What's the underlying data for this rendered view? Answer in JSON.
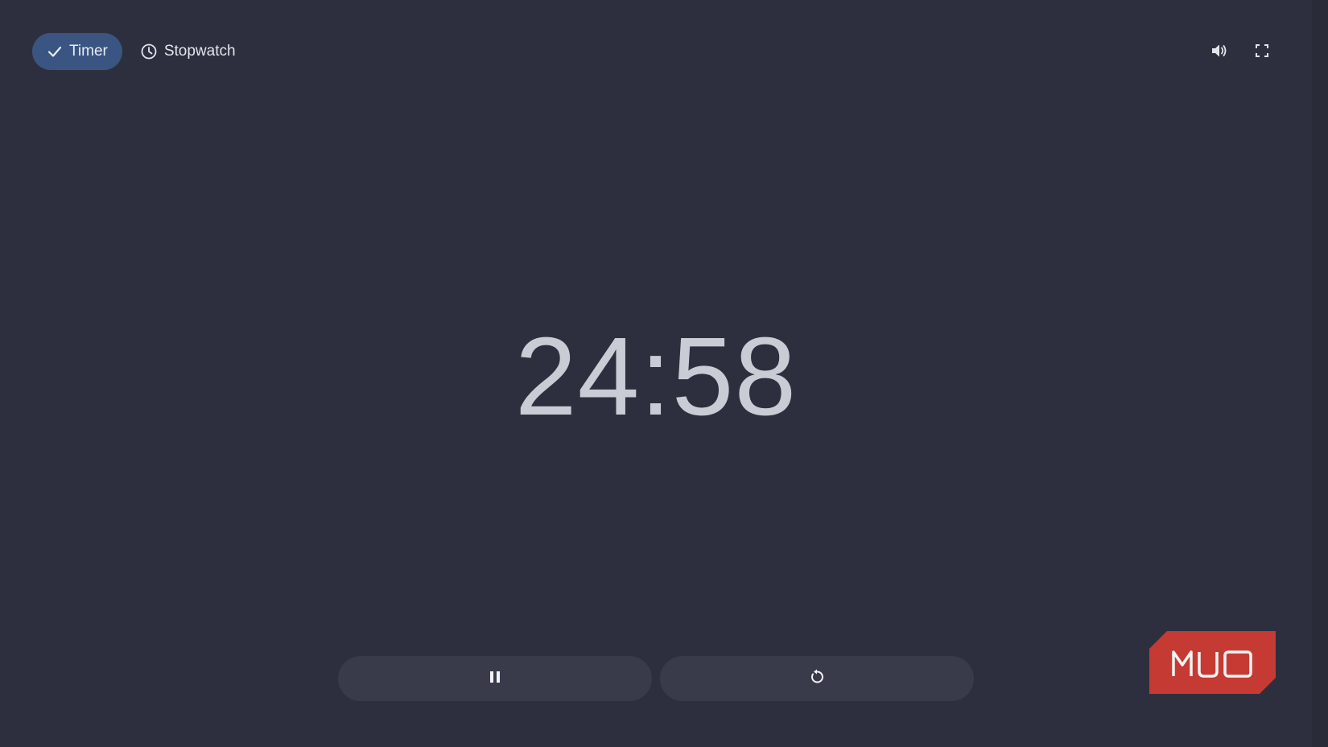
{
  "modes": {
    "timer_label": "Timer",
    "stopwatch_label": "Stopwatch",
    "active": "Timer"
  },
  "top_icons": [
    "volume-icon",
    "fullscreen-icon"
  ],
  "timer": {
    "display": "24:58"
  },
  "controls": {
    "pause_icon": "pause-icon",
    "reset_icon": "reset-icon"
  },
  "watermark": {
    "text": "MUO"
  },
  "colors": {
    "background": "#2e2f3e",
    "active_chip": "#3a5581",
    "control_button": "#393b4b",
    "time_text": "#c9cbd5",
    "logo_red": "#c63a34"
  }
}
